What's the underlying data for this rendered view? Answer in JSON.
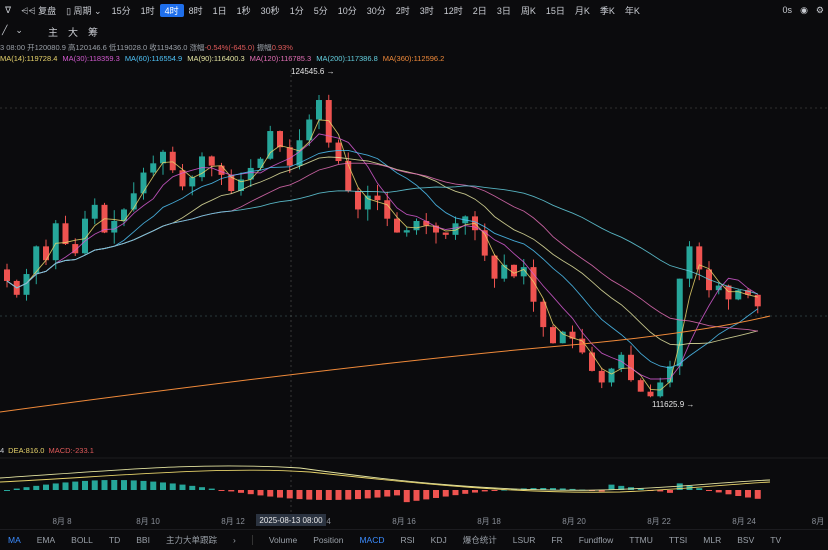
{
  "toolbar": {
    "left_items": [
      "ᐁ",
      "⩤⩤ 复盘",
      "▯ 周期 ⌄"
    ],
    "intervals": [
      "15分",
      "1时",
      "4时",
      "8时",
      "1日",
      "1秒",
      "30秒",
      "1分",
      "5分",
      "10分",
      "30分",
      "2时",
      "3时",
      "12时",
      "2日",
      "3日",
      "周K",
      "15日",
      "月K",
      "季K",
      "年K"
    ],
    "active_interval": "4时",
    "right_text": "0s"
  },
  "indicator_tabs": [
    "主",
    "大",
    "筹"
  ],
  "ohlc": {
    "time": "3 08:00",
    "open_label": "开",
    "open": "120080.9",
    "high_label": "高",
    "high": "120146.6",
    "low_label": "低",
    "low": "119028.0",
    "close_label": "收",
    "close": "119436.0",
    "change_label": "涨幅",
    "change": "-0.54%(-645.0)",
    "amp_label": "振幅",
    "amp": "0.93%"
  },
  "ma_legend": [
    {
      "label": "MA(14):119728.4",
      "color": "#e7d36b"
    },
    {
      "label": "MA(30):118359.3",
      "color": "#d35ad0"
    },
    {
      "label": "MA(60):116554.9",
      "color": "#4fc3f7"
    },
    {
      "label": "MA(90):116400.3",
      "color": "#e3e3a0"
    },
    {
      "label": "MA(120):116785.3",
      "color": "#e36fb6"
    },
    {
      "label": "MA(200):117386.8",
      "color": "#64d0e0"
    },
    {
      "label": "MA(360):112596.2",
      "color": "#f08a3a"
    }
  ],
  "price_labels": {
    "high": "124545.6",
    "low": "111625.9"
  },
  "macd_legend": [
    {
      "label": "4",
      "color": "#c9ccd2"
    },
    {
      "label": "DEA:816.0",
      "color": "#e7d36b"
    },
    {
      "label": "MACD:-233.1",
      "color": "#e05a5a"
    }
  ],
  "x_axis": {
    "labels": [
      "8月 8",
      "8月 10",
      "8月 12",
      "8月 14",
      "8月 16",
      "8月 18",
      "8月 20",
      "8月 22",
      "8月 24",
      "8月"
    ],
    "crosshair_time": "2025-08-13 08:00"
  },
  "bottom_tabs": {
    "main": [
      "MA",
      "EMA",
      "BOLL",
      "TD",
      "BBI",
      "主力大单跟踪"
    ],
    "sub": [
      "Volume",
      "Position",
      "MACD",
      "RSI",
      "KDJ",
      "爆仓统计",
      "LSUR",
      "FR",
      "Fundflow",
      "TTMU",
      "TTSI",
      "MLR",
      "BSV",
      "TV"
    ],
    "active_main": "MA",
    "active_sub": "MACD"
  },
  "colors": {
    "up": "#26a69a",
    "down": "#ef5350",
    "accent": "#1f6feb"
  }
}
